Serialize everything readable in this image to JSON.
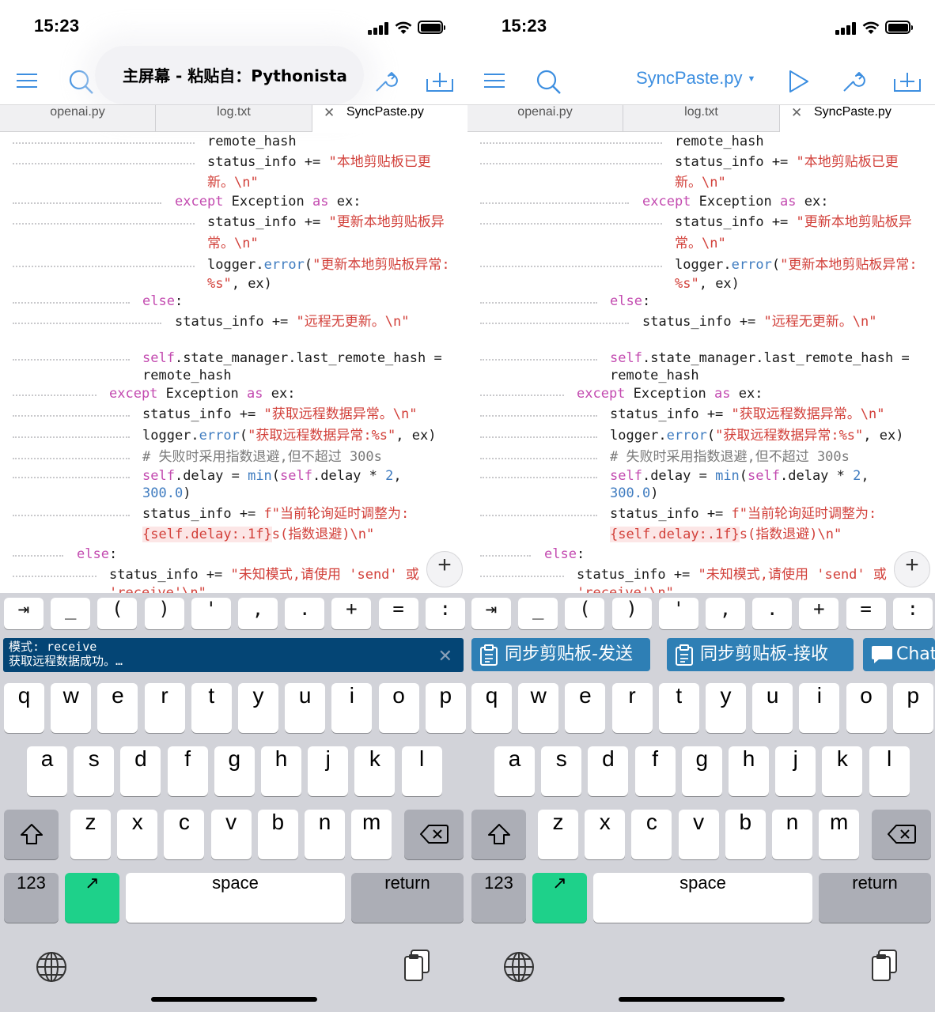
{
  "status": {
    "time": "15:23"
  },
  "left": {
    "banner": "主屏幕 - 粘贴自：Pythonista",
    "notification": {
      "line1": "模式: receive",
      "line2": "获取远程数据成功。…",
      "close": "✕"
    }
  },
  "right": {
    "filename": "SyncPaste.py",
    "shortcut_buttons": [
      {
        "label": "同步剪贴板-发送",
        "icon": "clipboard-icon"
      },
      {
        "label": "同步剪贴板-接收",
        "icon": "clipboard-icon"
      },
      {
        "label": "Chat",
        "icon": "chat-bubble-icon"
      }
    ]
  },
  "tabs": [
    {
      "label": "openai.py"
    },
    {
      "label": "log.txt"
    },
    {
      "label": "SyncPaste.py",
      "close": "✕",
      "active": true
    }
  ],
  "code_lines": [
    "remote_hash",
    "status_info += \"本地剪贴板已更",
    "新。\\n\"",
    "except Exception as ex:",
    "status_info += \"更新本地剪贴板异",
    "常。\\n\"",
    "logger.error(\"更新本地剪贴板异常:",
    "%s\", ex)",
    "else:",
    "status_info += \"远程无更新。\\n\"",
    "self.state_manager.last_remote_hash =",
    "remote_hash",
    "except Exception as ex:",
    "status_info += \"获取远程数据异常。\\n\"",
    "logger.error(\"获取远程数据异常:%s\", ex)",
    "# 失败时采用指数退避,但不超过 300s",
    "self.delay = min(self.delay * 2,",
    "300.0)",
    "status_info += f\"当前轮询延时调整为:",
    "{self.delay:.1f}s(指数退避)\\n\"",
    "else:",
    "status_info += \"未知模式,请使用 'send' 或",
    "'receive'\\n\""
  ],
  "plus_button": "+",
  "accessory_keys": [
    "⇥",
    "_",
    "(",
    ")",
    "'",
    ",",
    ".",
    "+",
    "=",
    ":"
  ],
  "keyboard": {
    "row1": [
      "q",
      "w",
      "e",
      "r",
      "t",
      "y",
      "u",
      "i",
      "o",
      "p"
    ],
    "row2": [
      "a",
      "s",
      "d",
      "f",
      "g",
      "h",
      "j",
      "k",
      "l"
    ],
    "row3": [
      "z",
      "x",
      "c",
      "v",
      "b",
      "n",
      "m"
    ],
    "numbers": "123",
    "space": "space",
    "return": "return",
    "shift_icon": "shift-icon",
    "delete_icon": "delete-icon",
    "globe_icon": "globe-icon",
    "paste_icon": "clipboard-icon",
    "action_glyph": "↗"
  },
  "colors": {
    "keyword": "#c34bb0",
    "string": "#d2403a",
    "function": "#3f7cc0",
    "accent": "#3c8ee0",
    "notification_bg": "#044575",
    "shortcut_bg": "#2e7fb5",
    "green_key": "#1ed18a"
  }
}
